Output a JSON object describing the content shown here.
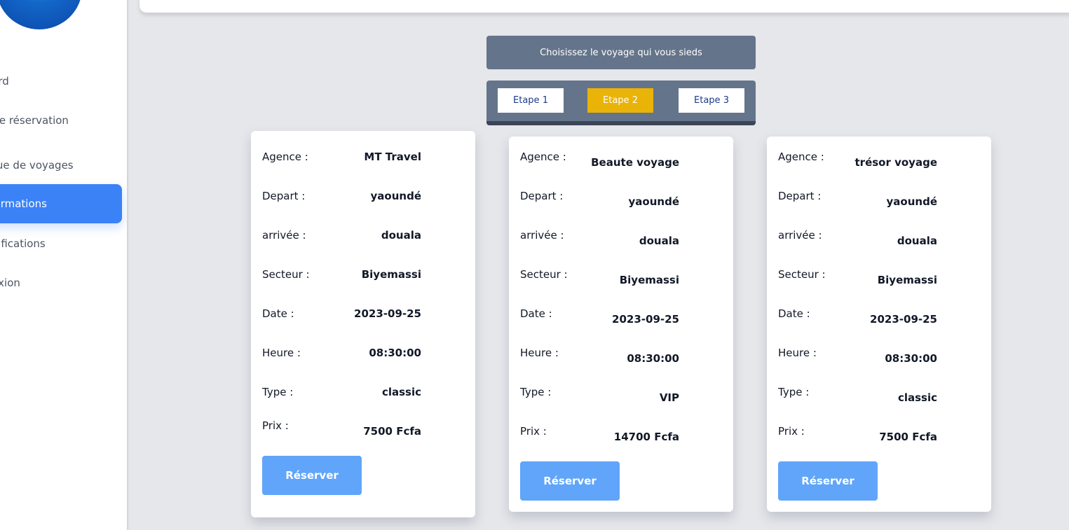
{
  "sidebar": {
    "items": [
      {
        "label": "nboard",
        "active": false
      },
      {
        "label": "re une réservation",
        "active": false
      },
      {
        "label": "torique de voyages",
        "active": false
      },
      {
        "label": "s informations",
        "active": true
      },
      {
        "label": "s notifications",
        "active": false
      },
      {
        "label": "onnexion",
        "active": false
      }
    ]
  },
  "instruction": "Choisissez le voyage qui vous sieds",
  "steps": [
    {
      "label": "Etape 1",
      "active": false
    },
    {
      "label": "Etape 2",
      "active": true
    },
    {
      "label": "Etape 3",
      "active": false
    }
  ],
  "labels": {
    "agence": "Agence :",
    "depart": "Depart :",
    "arrivee": "arrivée :",
    "secteur": "Secteur :",
    "date": "Date :",
    "heure": "Heure :",
    "type": "Type :",
    "prix": "Prix :"
  },
  "cards": [
    {
      "agence": "MT Travel",
      "depart": "yaoundé",
      "arrivee": "douala",
      "secteur": "Biyemassi",
      "date": "2023-09-25",
      "heure": "08:30:00",
      "type": "classic",
      "prix": "7500 Fcfa",
      "button": "Réserver"
    },
    {
      "agence": "Beaute voyage",
      "depart": "yaoundé",
      "arrivee": "douala",
      "secteur": "Biyemassi",
      "date": "2023-09-25",
      "heure": "08:30:00",
      "type": "VIP",
      "prix": "14700 Fcfa",
      "button": "Réserver"
    },
    {
      "agence": "trésor voyage",
      "depart": "yaoundé",
      "arrivee": "douala",
      "secteur": "Biyemassi",
      "date": "2023-09-25",
      "heure": "08:30:00",
      "type": "classic",
      "prix": "7500 Fcfa",
      "button": "Réserver"
    }
  ]
}
